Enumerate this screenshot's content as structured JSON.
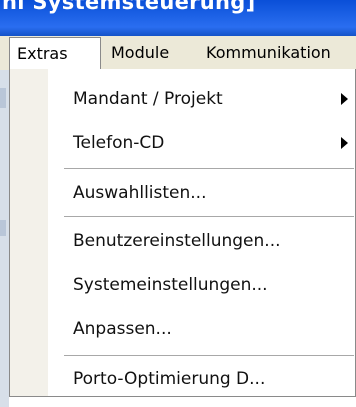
{
  "window": {
    "title_fragment": "nl Systemsteuerung]"
  },
  "menubar": {
    "items": [
      {
        "label": "Extras"
      },
      {
        "label": "Module"
      },
      {
        "label": "Kommunikation"
      }
    ]
  },
  "dropdown": {
    "items": [
      {
        "label": "Mandant / Projekt",
        "submenu": true
      },
      {
        "label": "Telefon-CD",
        "submenu": true
      },
      {
        "label": "Auswahllisten..."
      },
      {
        "label": "Benutzereinstellungen..."
      },
      {
        "label": "Systemeinstellungen..."
      },
      {
        "label": "Anpassen..."
      },
      {
        "label": "Porto-Optimierung D..."
      }
    ],
    "submenu_arrow_icon": "triangle-right-icon"
  },
  "colors": {
    "titlebar": "#1d62e6",
    "menubar": "#ece9d8",
    "menu_background": "#ffffff",
    "menu_border": "#8a8a8a"
  }
}
